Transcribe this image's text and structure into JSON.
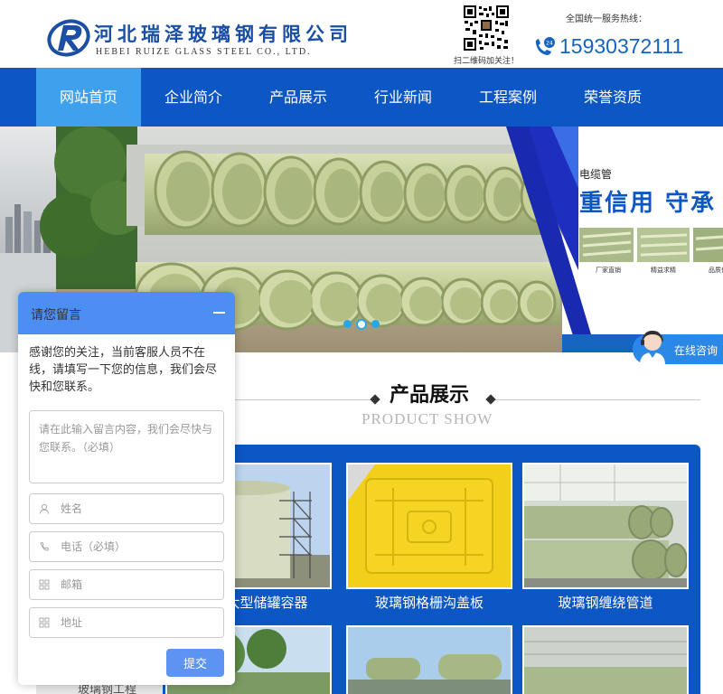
{
  "header": {
    "company_name_cn": "河北瑞泽玻璃钢有限公司",
    "company_name_en": "HEBEI RUIZE GLASS STEEL CO., LTD.",
    "qr_caption": "扫二维码加关注！",
    "hotline_label": "全国统一服务热线：",
    "phone": "15930372111",
    "brand_color": "#1a4fa3"
  },
  "nav": {
    "items": [
      {
        "label": "网站首页",
        "active": true
      },
      {
        "label": "企业简介"
      },
      {
        "label": "产品展示"
      },
      {
        "label": "行业新闻"
      },
      {
        "label": "工程案例"
      },
      {
        "label": "荣誉资质"
      }
    ],
    "color": "#0d57c4",
    "active_color": "#3fa1ee"
  },
  "banner": {
    "small_label": "电缆管",
    "big_label": "重信用  守承",
    "thumb_captions": [
      "厂家直销",
      "精益求精",
      "品质保证"
    ],
    "slide_count": 3,
    "active_slide": 2
  },
  "online_consult": {
    "label": "在线咨询"
  },
  "products": {
    "title": "产品展示",
    "subtitle": "PRODUCT SHOW",
    "items": [
      {
        "label": "玻璃钢大型储罐容器"
      },
      {
        "label": "玻璃钢格栅沟盖板"
      },
      {
        "label": "玻璃钢缠绕管道"
      }
    ],
    "bottom_partial": "玻璃钢工程"
  },
  "message_box": {
    "title": "请您留言",
    "intro": "感谢您的关注，当前客服人员不在线，请填写一下您的信息，我们会尽快和您联系。",
    "textarea_placeholder": "请在此输入留言内容，我们会尽快与您联系。（必填）",
    "name_placeholder": "姓名",
    "phone_placeholder": "电话（必填）",
    "email_placeholder": "邮箱",
    "address_placeholder": "地址",
    "submit_label": "提交"
  }
}
